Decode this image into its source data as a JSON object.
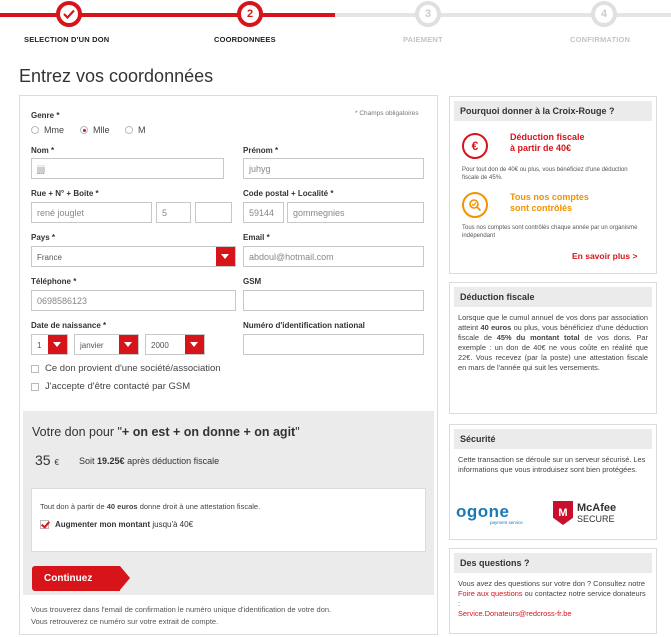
{
  "steps": [
    {
      "number": "",
      "label": "SELECTION D'UN DON",
      "state": "done"
    },
    {
      "number": "2",
      "label": "COORDONNEES",
      "state": "active"
    },
    {
      "number": "3",
      "label": "PAIEMENT",
      "state": "todo"
    },
    {
      "number": "4",
      "label": "CONFIRMATION",
      "state": "todo"
    }
  ],
  "page_title": "Entrez vos coordonnées",
  "form": {
    "required_note": "* Champs obligatoires",
    "genre_label": "Genre *",
    "genre_options": [
      "Mme",
      "Mlle",
      "M"
    ],
    "genre_selected": "Mlle",
    "nom_label": "Nom *",
    "nom_value": "jjjj",
    "prenom_label": "Prénom *",
    "prenom_value": "juhyg",
    "rue_label": "Rue + N° + Boite *",
    "rue_value": "rené jouglet",
    "numero_value": "5",
    "boite_value": "",
    "cp_label": "Code postal + Localité *",
    "cp_value": "59144",
    "localite_value": "gommegnies",
    "pays_label": "Pays *",
    "pays_value": "France",
    "email_label": "Email *",
    "email_value": "abdoul@hotmail.com",
    "telephone_label": "Téléphone *",
    "telephone_value": "0698586123",
    "gsm_label": "GSM",
    "gsm_value": "",
    "dob_label": "Date de naissance *",
    "dob_day": "1",
    "dob_month": "janvier",
    "dob_year": "2000",
    "nin_label": "Numéro d'identification national",
    "nin_value": "",
    "check_societe": "Ce don provient d'une société/association",
    "check_gsm": "J'accepte d'être contacté par GSM"
  },
  "donation": {
    "title_prefix": "Votre don pour \"",
    "title_bold": "+ on est + on donne + on agit",
    "title_suffix": "\"",
    "amount": "35",
    "currency": "€",
    "soit_prefix": "Soit",
    "soit_amount": "19.25€",
    "soit_suffix": "après déduction fiscale",
    "attest_prefix": "Tout don à partir de",
    "attest_bold": "40 euros",
    "attest_suffix": "donne droit à une attestation fiscale.",
    "augment_bold": "Augmenter mon montant",
    "augment_rest": "jusqu'à 40€",
    "continue_label": "Continuez",
    "footnote1": "Vous trouverez dans l'email de confirmation le numéro unique d'identification de votre don.",
    "footnote2": "Vous retrouverez ce numéro sur votre extrait de compte."
  },
  "sidebar": {
    "why": {
      "title": "Pourquoi donner à la Croix-Rouge ?",
      "f1_title_line1": "Déduction fiscale",
      "f1_title_line2": "à partir de 40€",
      "f1_desc": "Pour tout don de 40€ ou plus, vous bénéficiez d'une déduction fiscale de 45%.",
      "f2_title_line1": "Tous nos comptes",
      "f2_title_line2": "sont contrôlés",
      "f2_desc": "Tous nos comptes sont contrôlés chaque année par un organisme indépendant",
      "more": "En savoir plus  >"
    },
    "deduction": {
      "title": "Déduction fiscale",
      "p1": "Lorsque que le cumul annuel de vos dons par association atteint",
      "p1_bold": "40 euros",
      "p2": "ou plus, vous bénéficiez d'une déduction fiscale de",
      "p2_bold": "45% du montant total",
      "p3": "de vos dons. Par exemple : un don de 40€ ne vous coûte en réalité que 22€. Vous recevez (par la poste) une attestation fiscale en mars de l'année qui suit les versements."
    },
    "security": {
      "title": "Sécurité",
      "text": "Cette transaction se déroule sur un serveur sécurisé. Les informations que vous introduisez sont bien protégées.",
      "ogone": "ogone",
      "ogone_sub": "payment service",
      "mcafee": "McAfee",
      "secure": "SECURE"
    },
    "questions": {
      "title": "Des questions ?",
      "p1": "Vous avez des questions sur votre don ? Consultez notre",
      "faq_link": "Foire aux questions",
      "p2": "ou contactez notre service donateurs :",
      "email": "Service.Donateurs@redcross-fr.be"
    }
  },
  "colors": {
    "accent": "#d7141a",
    "orange": "#f39200",
    "panel_gray": "#ebebeb",
    "ogone_blue": "#1a7ab8"
  }
}
